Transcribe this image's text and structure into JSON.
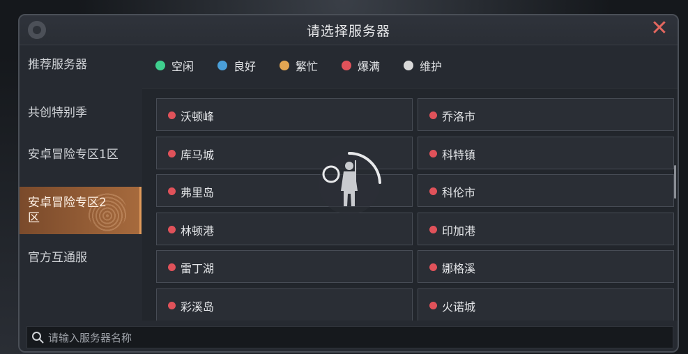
{
  "dialog": {
    "title": "请选择服务器"
  },
  "sidebar": {
    "items": [
      {
        "label": "推荐服务器"
      },
      {
        "label": "共创特别季"
      },
      {
        "label": "安卓冒险专区1区"
      },
      {
        "label": "安卓冒险专区2区"
      },
      {
        "label": "官方互通服"
      }
    ],
    "active_index": 3
  },
  "legend": [
    {
      "label": "空闲",
      "color": "#3fcf8e"
    },
    {
      "label": "良好",
      "color": "#4a9fd8"
    },
    {
      "label": "繁忙",
      "color": "#e2a552"
    },
    {
      "label": "爆满",
      "color": "#e0525a"
    },
    {
      "label": "维护",
      "color": "#d9d9d9"
    }
  ],
  "servers": [
    {
      "name": "沃顿峰",
      "status": "爆满"
    },
    {
      "name": "乔洛市",
      "status": "爆满"
    },
    {
      "name": "库马城",
      "status": "爆满"
    },
    {
      "name": "科特镇",
      "status": "爆满"
    },
    {
      "name": "弗里岛",
      "status": "爆满"
    },
    {
      "name": "科伦市",
      "status": "爆满"
    },
    {
      "name": "林顿港",
      "status": "爆满"
    },
    {
      "name": "印加港",
      "status": "爆满"
    },
    {
      "name": "雷丁湖",
      "status": "爆满"
    },
    {
      "name": "娜格溪",
      "status": "爆满"
    },
    {
      "name": "彩溪岛",
      "status": "爆满"
    },
    {
      "name": "火诺城",
      "status": "爆满"
    }
  ],
  "search": {
    "placeholder": "请输入服务器名称",
    "value": ""
  },
  "icons": {
    "close": "close-icon",
    "search": "search-icon",
    "loading": "loading-spinner-icon"
  }
}
